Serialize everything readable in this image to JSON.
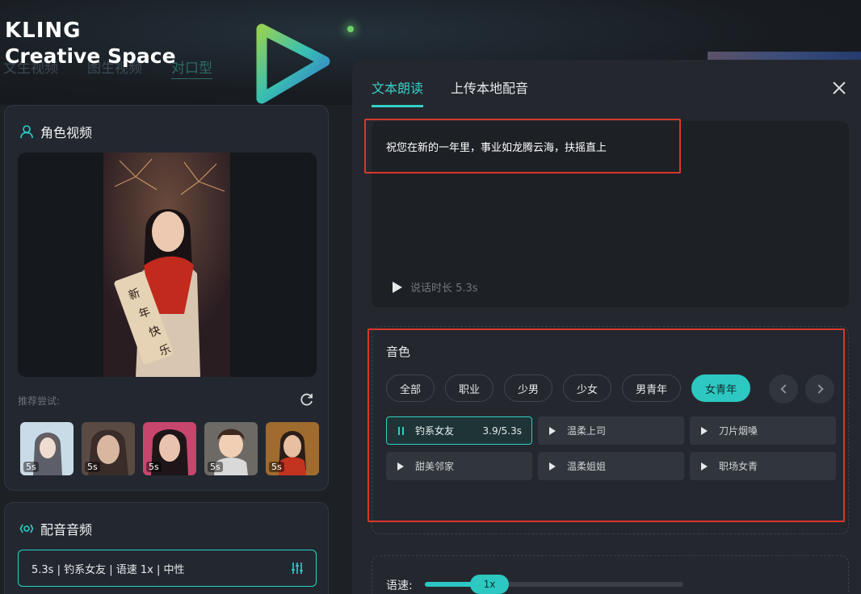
{
  "brand": {
    "line1": "KLING",
    "line2": "Creative Space"
  },
  "background_tabs": [
    {
      "label": "文生视频"
    },
    {
      "label": "图生视频"
    },
    {
      "label": "对口型"
    }
  ],
  "role_card": {
    "title": "角色视频",
    "suggest_label": "推荐尝试:",
    "thumbnails": [
      {
        "duration": "5s"
      },
      {
        "duration": "5s"
      },
      {
        "duration": "5s"
      },
      {
        "duration": "5s"
      },
      {
        "duration": "5s"
      }
    ]
  },
  "audio_card": {
    "title": "配音音频",
    "summary": "5.3s | 钓系女友 | 语速 1x | 中性"
  },
  "panel": {
    "tabs": [
      {
        "label": "文本朗读",
        "active": true
      },
      {
        "label": "上传本地配音",
        "active": false
      }
    ],
    "text": "祝您在新的一年里，事业如龙腾云海，扶摇直上",
    "play_label": "说话时长 5.3s",
    "voice": {
      "title": "音色",
      "filters": [
        {
          "label": "全部",
          "active": false
        },
        {
          "label": "职业",
          "active": false
        },
        {
          "label": "少男",
          "active": false
        },
        {
          "label": "少女",
          "active": false
        },
        {
          "label": "男青年",
          "active": false
        },
        {
          "label": "女青年",
          "active": true
        }
      ],
      "items": [
        {
          "name": "钓系女友",
          "selected": true,
          "duration": "3.9/5.3s"
        },
        {
          "name": "温柔上司",
          "selected": false
        },
        {
          "name": "刀片烟嗓",
          "selected": false
        },
        {
          "name": "甜美邻家",
          "selected": false
        },
        {
          "name": "温柔姐姐",
          "selected": false
        },
        {
          "name": "职场女青",
          "selected": false
        }
      ]
    },
    "speed": {
      "label": "语速:",
      "value": "1x",
      "level": 0.25
    }
  },
  "colors": {
    "accent": "#2cc8c1",
    "highlight_box": "#d8382b",
    "panel_bg": "#24282e",
    "page_bg": "#1d2024"
  }
}
